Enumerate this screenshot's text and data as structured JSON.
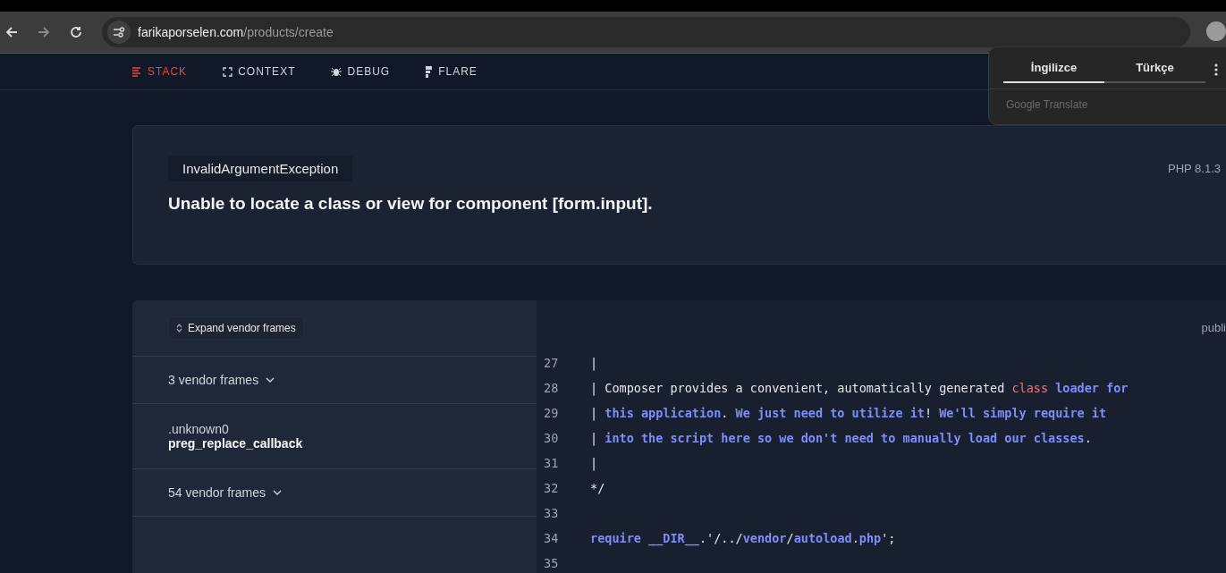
{
  "browser": {
    "url_host": "farikaporselen.com",
    "url_path": "/products/create"
  },
  "nav": [
    {
      "label": "STACK",
      "selected": true
    },
    {
      "label": "CONTEXT",
      "selected": false
    },
    {
      "label": "DEBUG",
      "selected": false
    },
    {
      "label": "FLARE",
      "selected": false
    }
  ],
  "translate_popup": {
    "tabs": [
      {
        "label": "İngilizce",
        "selected": true
      },
      {
        "label": "Türkçe",
        "selected": false
      }
    ],
    "footer": "Google Translate"
  },
  "error": {
    "exception": "InvalidArgumentException",
    "version": "PHP 8.1.3",
    "message": "Unable to locate a class or view for component [form.input]."
  },
  "stack": {
    "expand_button": "Expand vendor frames",
    "frames": [
      {
        "kind": "vendor",
        "label": "3 vendor frames"
      },
      {
        "kind": "frame",
        "file": ".unknown0",
        "method": "preg_replace_callback"
      },
      {
        "kind": "vendor",
        "label": "54 vendor frames"
      }
    ]
  },
  "code": {
    "path": "publi",
    "lines": [
      {
        "number": "27",
        "segments": [
          {
            "kind": "plain",
            "text": "|"
          }
        ]
      },
      {
        "number": "28",
        "segments": [
          {
            "kind": "plain",
            "text": "| Composer provides a convenient, automatically generated "
          },
          {
            "kind": "keyword",
            "text": "class"
          },
          {
            "kind": "ident",
            "text": " loader for"
          }
        ]
      },
      {
        "number": "29",
        "segments": [
          {
            "kind": "plain",
            "text": "| "
          },
          {
            "kind": "ident",
            "text": "this application"
          },
          {
            "kind": "plain",
            "text": "."
          },
          {
            "kind": "ident",
            "text": " We just need to utilize it"
          },
          {
            "kind": "plain",
            "text": "!"
          },
          {
            "kind": "ident",
            "text": " We'll simply require it"
          }
        ]
      },
      {
        "number": "30",
        "segments": [
          {
            "kind": "plain",
            "text": "| "
          },
          {
            "kind": "ident",
            "text": "into the script here so we don't need to manually load our classes"
          },
          {
            "kind": "plain",
            "text": "."
          }
        ]
      },
      {
        "number": "31",
        "segments": [
          {
            "kind": "plain",
            "text": "|"
          }
        ]
      },
      {
        "number": "32",
        "segments": [
          {
            "kind": "plain",
            "text": "*/"
          }
        ]
      },
      {
        "number": "33"
      },
      {
        "number": "34",
        "segments": [
          {
            "kind": "ident",
            "text": "require __DIR__"
          },
          {
            "kind": "plain",
            "text": ".'/../"
          },
          {
            "kind": "ident",
            "text": "vendor"
          },
          {
            "kind": "plain",
            "text": "/"
          },
          {
            "kind": "ident",
            "text": "autoload"
          },
          {
            "kind": "plain",
            "text": "."
          },
          {
            "kind": "ident",
            "text": "php"
          },
          {
            "kind": "plain",
            "text": "';"
          }
        ]
      },
      {
        "number": "35"
      }
    ]
  }
}
